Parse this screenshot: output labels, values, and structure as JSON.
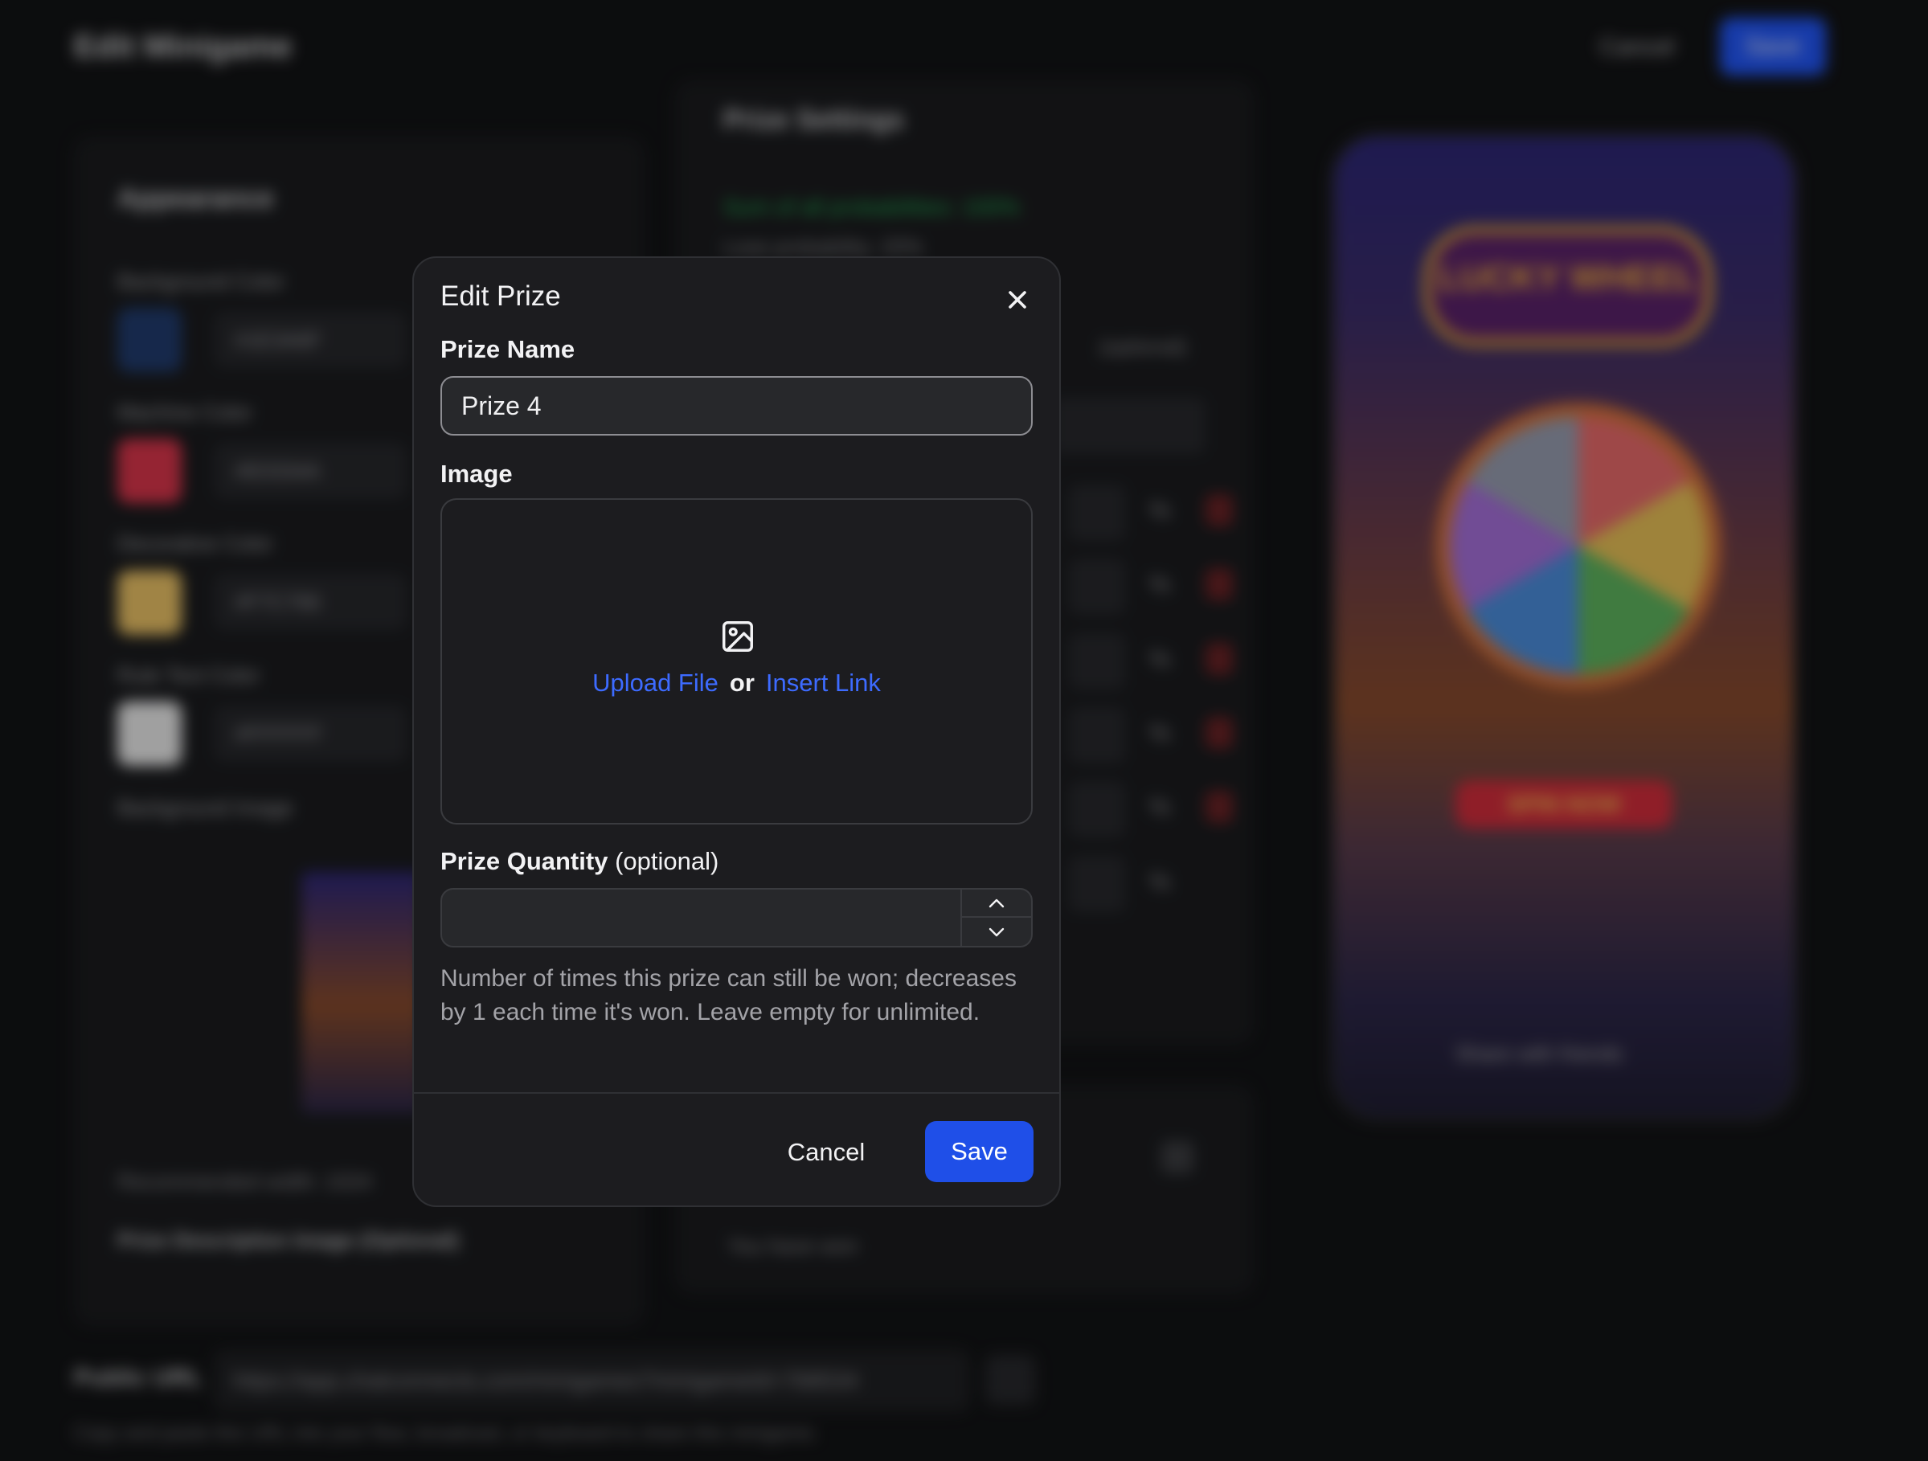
{
  "background": {
    "page_title": "Edit Minigame",
    "top_cancel": "Cancel",
    "top_save": "Save",
    "appearance": {
      "heading": "Appearance",
      "colors": [
        {
          "label": "Background Color",
          "hex": "#1E3A6F"
        },
        {
          "label": "Machine Color",
          "hex": "#E0334A"
        },
        {
          "label": "Decorative Color",
          "hex": "#F7C766"
        },
        {
          "label": "Rule Text Color",
          "hex": "#FFFFFF"
        }
      ],
      "background_image_label": "Background Image",
      "recommended": "Recommended width: 1024",
      "prize_description_label": "Prize Description Image (Optional)"
    },
    "prize_settings": {
      "heading": "Prize Settings",
      "sum_text": "Sum of all probabilities: 100%",
      "lose_text": "Lose probability: 20%",
      "optional": "(optional)",
      "footer_text": "You have won"
    },
    "public_url": {
      "label": "Public URL",
      "value": "https://app.chatconnects.com/minigames?minigameId=768534",
      "help": "Copy and paste this URL into your flow, broadcast, or keyboard to share this minigame."
    },
    "preview": {
      "marquee_text": "LUCKY WHEEL",
      "spin_text": "SPIN NOW",
      "share_text": "Share with friends"
    }
  },
  "modal": {
    "title": "Edit Prize",
    "prize_name_label": "Prize Name",
    "prize_name_value": "Prize 4",
    "image_label": "Image",
    "upload_file": "Upload File",
    "or": "or",
    "insert_link": "Insert Link",
    "quantity_label": "Prize Quantity",
    "quantity_optional": "(optional)",
    "quantity_value": "",
    "quantity_help": "Number of times this prize can still be won; decreases by 1 each time it's won. Leave empty for unlimited.",
    "cancel": "Cancel",
    "save": "Save"
  },
  "colors": {
    "accent": "#1F4FE8",
    "link": "#3D6BFF",
    "modal_bg": "#1C1C1F"
  }
}
